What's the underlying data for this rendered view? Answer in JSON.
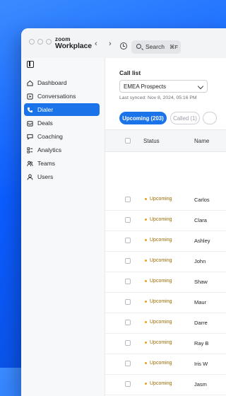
{
  "app": {
    "logo_top": "zoom",
    "logo_main": "Workplace"
  },
  "toolbar": {
    "back": "‹",
    "forward": "›",
    "search_placeholder": "Search",
    "search_shortcut": "⌘F"
  },
  "sidebar": {
    "items": [
      {
        "label": "Dashboard",
        "icon": "home-icon"
      },
      {
        "label": "Conversations",
        "icon": "play-icon"
      },
      {
        "label": "Dialer",
        "icon": "phone-icon",
        "active": true
      },
      {
        "label": "Deals",
        "icon": "inbox-icon"
      },
      {
        "label": "Coaching",
        "icon": "chat-icon"
      },
      {
        "label": "Analytics",
        "icon": "analytics-icon"
      },
      {
        "label": "Teams",
        "icon": "people-icon"
      },
      {
        "label": "Users",
        "icon": "user-icon"
      }
    ]
  },
  "main": {
    "call_list_title": "Call list",
    "call_list_selected": "EMEA Prospects",
    "last_synced": "Last synced: Nov 8, 2024, 05:16 PM",
    "tabs": [
      {
        "label": "Upcoming (203)",
        "active": true
      },
      {
        "label": "Called (1)",
        "active": false
      },
      {
        "label": "",
        "active": false
      }
    ],
    "columns": [
      "Status",
      "Name"
    ],
    "rows": [
      {
        "status": "Upcoming",
        "name": "Carlos"
      },
      {
        "status": "Upcoming",
        "name": "Clara"
      },
      {
        "status": "Upcoming",
        "name": "Ashley"
      },
      {
        "status": "Upcoming",
        "name": "John"
      },
      {
        "status": "Upcoming",
        "name": "Shaw"
      },
      {
        "status": "Upcoming",
        "name": "Maur"
      },
      {
        "status": "Upcoming",
        "name": "Darre"
      },
      {
        "status": "Upcoming",
        "name": "Ray B"
      },
      {
        "status": "Upcoming",
        "name": "Iris W"
      },
      {
        "status": "Upcoming",
        "name": "Jasm"
      }
    ]
  },
  "colors": {
    "accent": "#1a73e8",
    "background": "#0b5cff",
    "status_dot": "#e3a21a"
  }
}
